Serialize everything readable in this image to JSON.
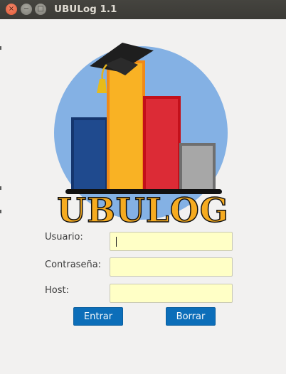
{
  "window": {
    "title": "UBULog 1.1",
    "controls": {
      "close": "×",
      "minimize": "−",
      "maximize": "□"
    }
  },
  "logo": {
    "text": "UBULOG",
    "colors": {
      "circle": "#84b1e4",
      "bar_blue": "#1f4a8e",
      "bar_yellow": "#f9b224",
      "bar_red": "#dc2b36",
      "bar_gray": "#a7a7a7",
      "text": "#f6ab20"
    }
  },
  "form": {
    "user_label": "Usuario:",
    "password_label": "Contraseña:",
    "host_label": "Host:",
    "user_value": "",
    "password_value": "",
    "host_value": ""
  },
  "buttons": {
    "enter": "Entrar",
    "clear": "Borrar"
  },
  "colors": {
    "field_bg": "#ffffc6",
    "button_bg": "#0c6eb9"
  }
}
